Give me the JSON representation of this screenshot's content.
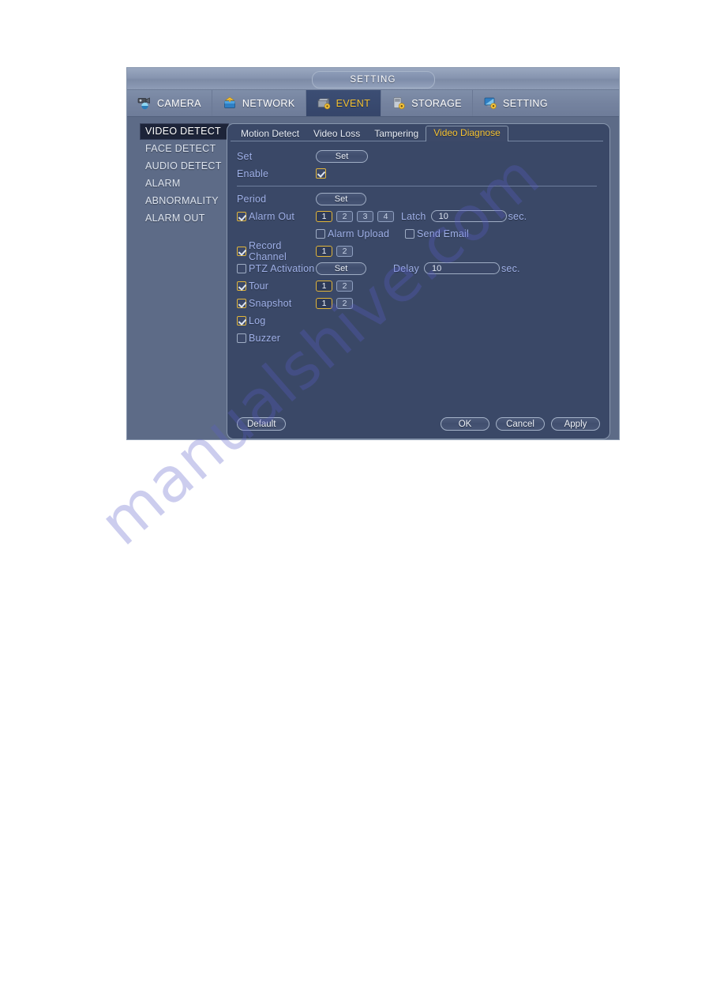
{
  "window": {
    "title": "SETTING"
  },
  "topnav": {
    "tabs": [
      {
        "label": "CAMERA",
        "icon": "camera-icon",
        "active": false
      },
      {
        "label": "NETWORK",
        "icon": "network-icon",
        "active": false
      },
      {
        "label": "EVENT",
        "icon": "event-icon",
        "active": true
      },
      {
        "label": "STORAGE",
        "icon": "storage-icon",
        "active": false
      },
      {
        "label": "SETTING",
        "icon": "setting-icon",
        "active": false
      }
    ]
  },
  "sidebar": {
    "items": [
      {
        "label": "VIDEO DETECT",
        "active": true
      },
      {
        "label": "FACE DETECT",
        "active": false
      },
      {
        "label": "AUDIO DETECT",
        "active": false
      },
      {
        "label": "ALARM",
        "active": false
      },
      {
        "label": "ABNORMALITY",
        "active": false
      },
      {
        "label": "ALARM OUT",
        "active": false
      }
    ]
  },
  "tabs": [
    {
      "label": "Motion Detect",
      "active": false
    },
    {
      "label": "Video Loss",
      "active": false
    },
    {
      "label": "Tampering",
      "active": false
    },
    {
      "label": "Video Diagnose",
      "active": true
    }
  ],
  "form": {
    "set": {
      "label": "Set",
      "button": "Set"
    },
    "enable": {
      "label": "Enable",
      "checked": true
    },
    "period": {
      "label": "Period",
      "button": "Set"
    },
    "alarm_out": {
      "label": "Alarm Out",
      "checked": true,
      "channels": [
        {
          "label": "1",
          "selected": true
        },
        {
          "label": "2",
          "selected": false
        },
        {
          "label": "3",
          "selected": false
        },
        {
          "label": "4",
          "selected": false
        }
      ],
      "latch_label": "Latch",
      "latch_value": "10",
      "latch_unit": "sec."
    },
    "alarm_upload": {
      "label": "Alarm Upload",
      "checked": false
    },
    "send_email": {
      "label": "Send Email",
      "checked": false
    },
    "record_channel": {
      "label": "Record Channel",
      "checked": true,
      "channels": [
        {
          "label": "1",
          "selected": true
        },
        {
          "label": "2",
          "selected": false
        }
      ]
    },
    "ptz_activation": {
      "label": "PTZ Activation",
      "checked": false,
      "button": "Set",
      "delay_label": "Delay",
      "delay_value": "10",
      "delay_unit": "sec."
    },
    "tour": {
      "label": "Tour",
      "checked": true,
      "channels": [
        {
          "label": "1",
          "selected": true
        },
        {
          "label": "2",
          "selected": false
        }
      ]
    },
    "snapshot": {
      "label": "Snapshot",
      "checked": true,
      "channels": [
        {
          "label": "1",
          "selected": true
        },
        {
          "label": "2",
          "selected": false
        }
      ]
    },
    "log": {
      "label": "Log",
      "checked": true
    },
    "buzzer": {
      "label": "Buzzer",
      "checked": false
    }
  },
  "footer": {
    "default_label": "Default",
    "ok_label": "OK",
    "cancel_label": "Cancel",
    "apply_label": "Apply"
  },
  "watermark": {
    "text": "manualshive.com"
  },
  "colors": {
    "accent_gold": "#f5c232",
    "label_blue": "#9fb0e8",
    "panel_bg": "#3a4867",
    "dialog_bg": "#5d6b87"
  }
}
